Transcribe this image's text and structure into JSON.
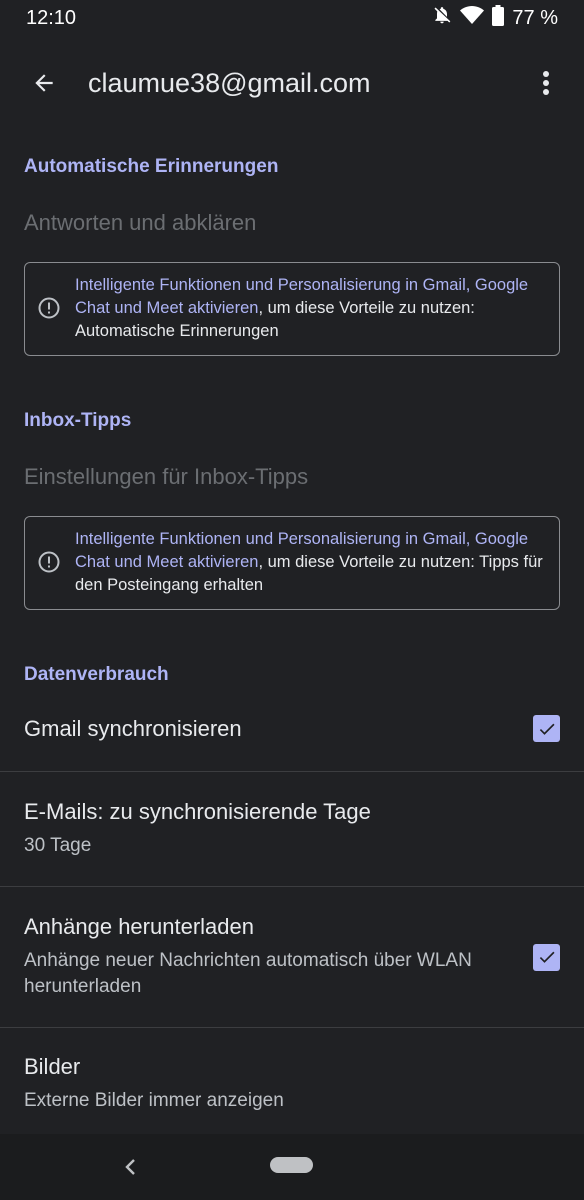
{
  "status_bar": {
    "time": "12:10",
    "battery": "77 %"
  },
  "app_bar": {
    "title": "claumue38@gmail.com"
  },
  "sections": {
    "reminders": {
      "header": "Automatische Erinnerungen",
      "item": "Antworten und abklären",
      "notice_link": "Intelligente Funktionen und Personalisierung in Gmail, Google Chat und Meet aktivieren",
      "notice_text": ", um diese Vorteile zu nutzen: Automatische Erinnerungen"
    },
    "inbox_tips": {
      "header": "Inbox-Tipps",
      "item": "Einstellungen für Inbox-Tipps",
      "notice_link": "Intelligente Funktionen und Personalisierung in Gmail, Google Chat und Meet aktivieren",
      "notice_text": ", um diese Vorteile zu nutzen: Tipps für den Posteingang erhalten"
    },
    "data_usage": {
      "header": "Datenverbrauch",
      "sync": {
        "label": "Gmail synchronisieren",
        "checked": true
      },
      "sync_days": {
        "label": "E-Mails: zu synchronisierende Tage",
        "value": "30 Tage"
      },
      "attachments": {
        "label": "Anhänge herunterladen",
        "description": "Anhänge neuer Nachrichten automatisch über WLAN herunterladen",
        "checked": true
      },
      "images": {
        "label": "Bilder",
        "value": "Externe Bilder immer anzeigen"
      }
    }
  },
  "colors": {
    "background": "#202124",
    "accent": "#aeb4f5",
    "disabled_text": "#6b6e72"
  },
  "icons": [
    "bell-off-icon",
    "wifi-icon",
    "battery-icon",
    "back-arrow-icon",
    "more-vert-icon",
    "info-icon",
    "checkbox-checked-icon",
    "nav-back-icon",
    "home-pill"
  ]
}
